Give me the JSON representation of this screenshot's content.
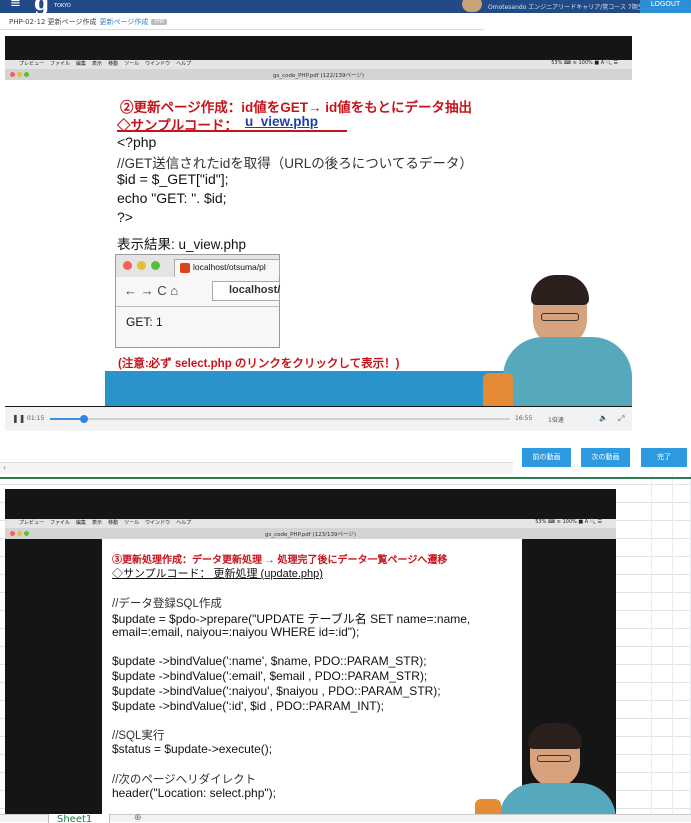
{
  "header": {
    "menu_icon": "hamburger-menu-icon",
    "logo": "g",
    "logo_sub": "TOKYO",
    "user_name": "Omotesando エンジニアリードキャリア/覚コース 7期生",
    "logout": "LOGOUT"
  },
  "breadcrumb": {
    "title": "PHP-02-12 更新ページ作成",
    "sub": "更新ページ作成",
    "badge": "PHP"
  },
  "video1": {
    "mac_menu": [
      "プレビュー",
      "ファイル",
      "編集",
      "表示",
      "移動",
      "ツール",
      "ウインドウ",
      "ヘルプ"
    ],
    "mac_status": "53% ⌨ ≋ 100% ■ A 🔍 ☰",
    "pdf_title": "gs_code_PHP.pdf (122/139ページ)",
    "slide": {
      "heading": "②更新ページ作成：id値をGET→ id値をもとにデータ抽出",
      "sample": "◇サンプルコード：",
      "sample_file": "u_view.php",
      "code": [
        "<?php",
        "//GET送信されたidを取得（URLの後ろについてるデータ）",
        "$id = $_GET[\"id\"];",
        "echo \"GET: \". $id;",
        "?>"
      ],
      "result_label": "表示結果: u_view.php",
      "browser_tab": "localhost/otsuma/pl",
      "browser_url": "localhost/",
      "browser_output": "GET: 1",
      "note": "(注意:必ず select.php のリンクをクリックして表示！)"
    },
    "controls": {
      "current_time": "01:15",
      "duration": "16:55",
      "speed": "1倍速",
      "progress": 0.074
    }
  },
  "nav_buttons": {
    "prev": "前の動画",
    "next": "次の動画",
    "done": "完了"
  },
  "video2": {
    "mac_menu": [
      "プレビュー",
      "ファイル",
      "編集",
      "表示",
      "移動",
      "ツール",
      "ウインドウ",
      "ヘルプ"
    ],
    "mac_status": "53% ⌨ ≋ 100% ■ A 🔍 ☰",
    "pdf_title": "gs_code_PHP.pdf (123/139ページ)",
    "slide": {
      "heading": "③更新処理作成：データ更新処理 → 処理完了後にデータ一覧ページへ遷移",
      "sample": "◇サンプルコード： 更新処理 (update.php)",
      "comment1": "//データ登録SQL作成",
      "sql1": "$update = $pdo->prepare(\"UPDATE テーブル名 SET name=:name,",
      "sql2": "email=:email, naiyou=:naiyou WHERE id=:id\");",
      "bind1": "$update ->bindValue(':name',    $name,   PDO::PARAM_STR);",
      "bind2": "$update ->bindValue(':email',    $email ,  PDO::PARAM_STR);",
      "bind3": "$update ->bindValue(':naiyou',  $naiyou , PDO::PARAM_STR);",
      "bind4": "$update ->bindValue(':id',         $id ,       PDO::PARAM_INT);",
      "comment2": "//SQL実行",
      "exec": "$status = $update->execute();",
      "comment3": "//次のページへリダイレクト",
      "redirect": "header(\"Location: select.php\");"
    }
  },
  "sheet": {
    "tab_name": "Sheet1",
    "add_icon": "⊕"
  }
}
